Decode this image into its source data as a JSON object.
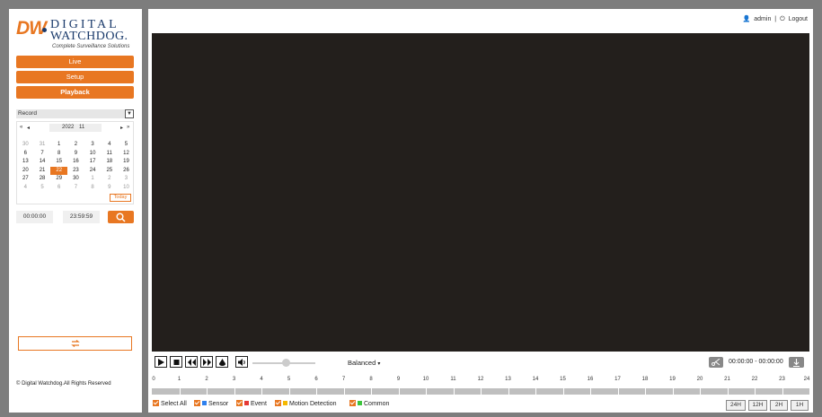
{
  "brand": {
    "logo_mark": "DW",
    "logo_line1": "DIGITAL",
    "logo_line2": "WATCHDOG.",
    "tagline": "Complete Surveillance Solutions",
    "accent": "#e87722"
  },
  "nav": {
    "live": "Live",
    "setup": "Setup",
    "playback": "Playback"
  },
  "record_type": "Record",
  "calendar": {
    "prev_year": "«",
    "prev_month": "◂",
    "year": "2022",
    "month": "11",
    "next_month": "▸",
    "next_year": "»",
    "weeks": [
      [
        "30",
        "31",
        "1",
        "2",
        "3",
        "4",
        "5"
      ],
      [
        "6",
        "7",
        "8",
        "9",
        "10",
        "11",
        "12"
      ],
      [
        "13",
        "14",
        "15",
        "16",
        "17",
        "18",
        "19"
      ],
      [
        "20",
        "21",
        "22",
        "23",
        "24",
        "25",
        "26"
      ],
      [
        "27",
        "28",
        "29",
        "30",
        "1",
        "2",
        "3"
      ],
      [
        "4",
        "5",
        "6",
        "7",
        "8",
        "9",
        "10"
      ]
    ],
    "selected_day": "22",
    "today_label": "Today"
  },
  "search": {
    "start_time": "00:00:00",
    "separator": "-",
    "end_time": "23:59:59",
    "icon": "search-icon"
  },
  "swap_icon": "swap-icon",
  "copyright": "© Digital Watchdog.All Rights Reserved",
  "topbar": {
    "user": "admin",
    "divider": "|",
    "logout": "Logout"
  },
  "controls": {
    "quality": "Balanced",
    "quality_caret": "▾",
    "time_range": "00:00:00 - 00:00:00"
  },
  "timeline": {
    "hours": [
      "0",
      "1",
      "2",
      "3",
      "4",
      "5",
      "6",
      "7",
      "8",
      "9",
      "10",
      "11",
      "12",
      "13",
      "14",
      "15",
      "16",
      "17",
      "18",
      "19",
      "20",
      "21",
      "22",
      "23",
      "24"
    ]
  },
  "legend": {
    "select_all": "Select All",
    "sensor": "Sensor",
    "event": "Event",
    "motion": "Motion Detection",
    "common": "Common",
    "colors": {
      "sensor": "#2f80ed",
      "event": "#e53935",
      "motion": "#f5b800",
      "common": "#3cc43c"
    }
  },
  "zoom": [
    "24H",
    "12H",
    "2H",
    "1H"
  ]
}
